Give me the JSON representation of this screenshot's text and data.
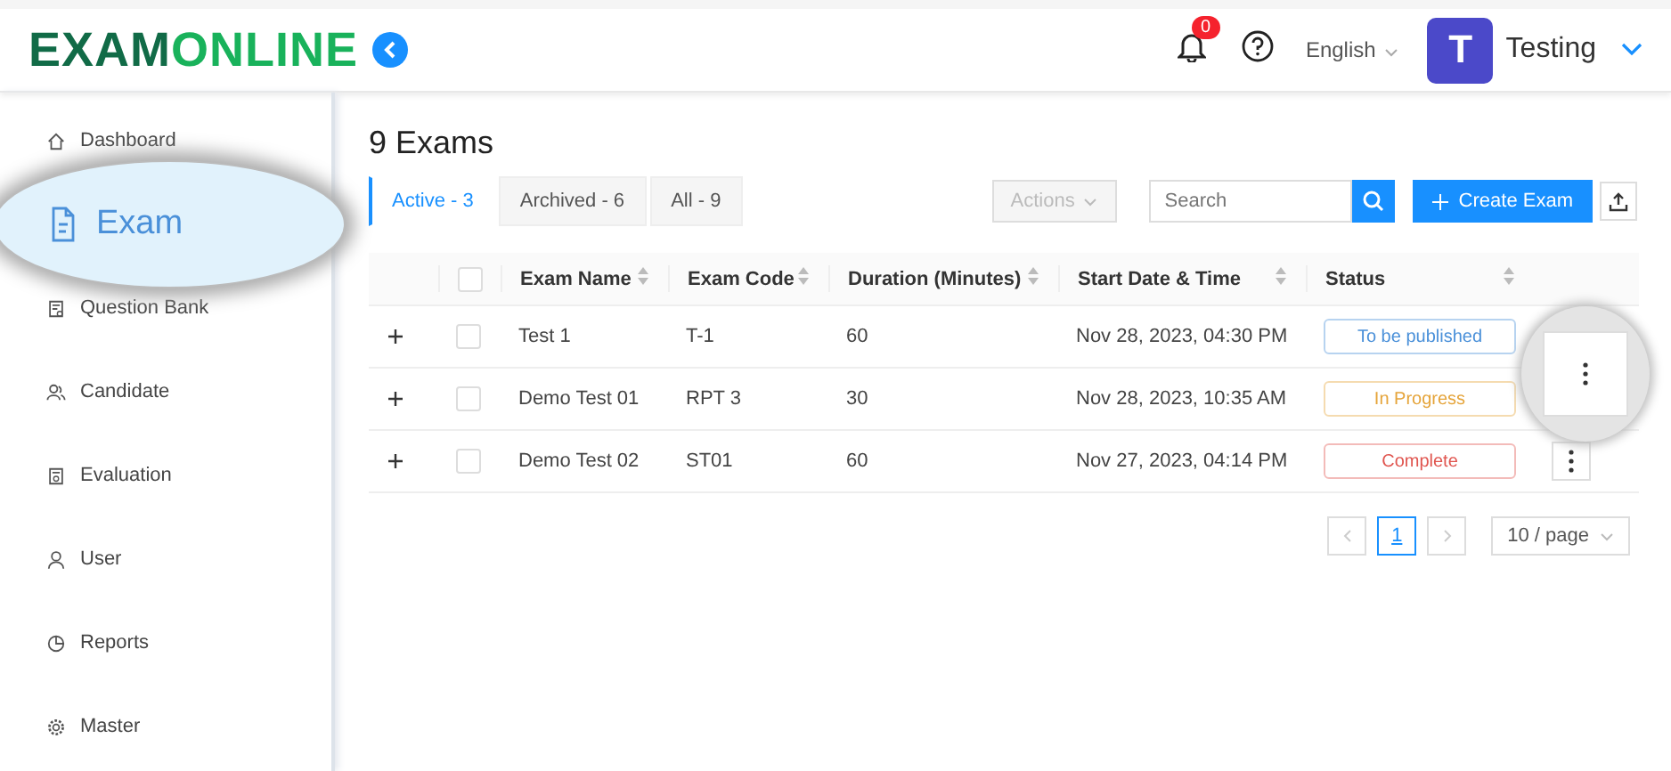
{
  "header": {
    "logo_dark": "EXAM",
    "logo_light": "ONLINE",
    "notifications": "0",
    "language": "English",
    "avatar": "T",
    "user": "Testing"
  },
  "sidebar": {
    "items": [
      {
        "label": "Dashboard",
        "selected": false
      },
      {
        "label": "Exam",
        "selected": true
      },
      {
        "label": "Question Bank",
        "selected": false
      },
      {
        "label": "Candidate",
        "selected": false
      },
      {
        "label": "Evaluation",
        "selected": false
      },
      {
        "label": "User",
        "selected": false
      },
      {
        "label": "Reports",
        "selected": false
      },
      {
        "label": "Master",
        "selected": false
      }
    ]
  },
  "page": {
    "title": "9 Exams",
    "tabs": [
      {
        "label": "Active - 3",
        "selected": true
      },
      {
        "label": "Archived - 6",
        "selected": false
      },
      {
        "label": "All - 9",
        "selected": false
      }
    ],
    "actions": "Actions",
    "search": {
      "placeholder": "Search"
    },
    "create": "Create Exam"
  },
  "table": {
    "select_all_checked": false,
    "columns": [
      "Exam Name",
      "Exam Code",
      "Duration (Minutes)",
      "Start Date & Time",
      "Status"
    ],
    "rows": [
      {
        "name": "Test 1",
        "code": "T-1",
        "duration": "60",
        "start": "Nov 28, 2023, 04:30 PM",
        "status": "To be published",
        "color": "#4a90d9",
        "checked": false,
        "magnified": true
      },
      {
        "name": "Demo Test 01",
        "code": "RPT 3",
        "duration": "30",
        "start": "Nov 28, 2023, 10:35 AM",
        "status": "In Progress",
        "color": "#e5a43a",
        "checked": false,
        "magnified": false
      },
      {
        "name": "Demo Test 02",
        "code": "ST01",
        "duration": "60",
        "start": "Nov 27, 2023, 04:14 PM",
        "status": "Complete",
        "color": "#e0554f",
        "checked": false,
        "magnified": false
      }
    ]
  },
  "pagination": {
    "pages": [
      {
        "label": "1",
        "selected": true
      }
    ],
    "page_size": "10 / page"
  }
}
